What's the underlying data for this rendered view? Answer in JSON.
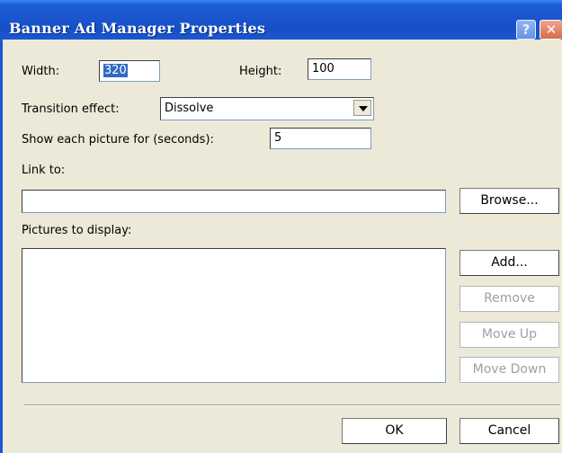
{
  "window": {
    "title": "Banner Ad Manager Properties",
    "help_glyph": "?",
    "close_glyph": "✕"
  },
  "form": {
    "width_label": "Width:",
    "width_value": "320",
    "height_label": "Height:",
    "height_value": "100",
    "transition_label": "Transition effect:",
    "transition_value": "Dissolve",
    "show_label": "Show each picture for (seconds):",
    "show_value": "5",
    "link_label": "Link to:",
    "link_value": "",
    "pictures_label": "Pictures to display:"
  },
  "buttons": {
    "browse": "Browse...",
    "add": "Add...",
    "remove": "Remove",
    "move_up": "Move Up",
    "move_down": "Move Down",
    "ok": "OK",
    "cancel": "Cancel"
  },
  "icons": {
    "dropdown": "chevron-down-icon",
    "help": "help-icon",
    "close": "close-icon"
  },
  "colors": {
    "titlebar": "#1a56cf",
    "dialog_bg": "#ece9d8",
    "selection": "#316ac5",
    "disabled_text": "#a0a0a0"
  }
}
